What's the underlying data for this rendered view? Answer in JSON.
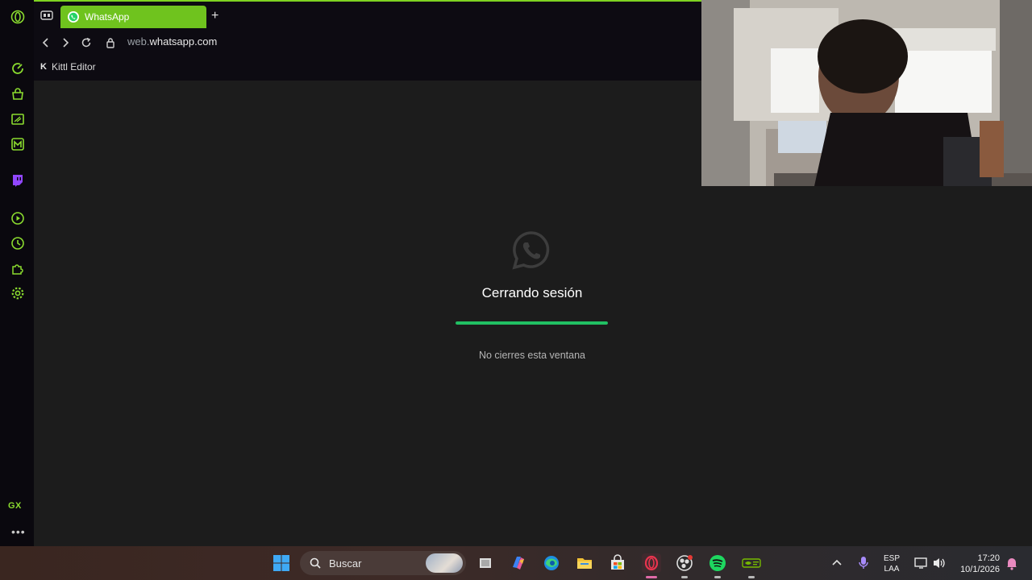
{
  "browser": {
    "tab": {
      "title": "WhatsApp"
    },
    "new_tab_symbol": "+",
    "address": {
      "url_prefix": "web.",
      "url_domain": "whatsapp.com"
    },
    "bookmarks": [
      {
        "label": "Kittl Editor",
        "icon": "kittl-icon"
      }
    ],
    "sidebar": {
      "items": [
        {
          "icon": "opera-logo-icon"
        },
        {
          "icon": "speed-dial-icon"
        },
        {
          "icon": "shopping-bag-icon"
        },
        {
          "icon": "gx-corner-icon"
        },
        {
          "icon": "messenger-m-icon"
        },
        {
          "icon": "twitch-icon"
        },
        {
          "icon": "player-icon"
        },
        {
          "icon": "history-icon"
        },
        {
          "icon": "extensions-icon"
        },
        {
          "icon": "settings-icon"
        }
      ],
      "gx_label": "GX",
      "more_label": "•••"
    },
    "accent_color": "#7ed321"
  },
  "page": {
    "title": "Cerrando sesión",
    "note": "No cierres esta ventana",
    "progress": 1.0,
    "progress_color": "#21c063"
  },
  "taskbar": {
    "search_placeholder": "Buscar",
    "apps": [
      {
        "name": "task-view"
      },
      {
        "name": "copilot"
      },
      {
        "name": "edge"
      },
      {
        "name": "file-explorer"
      },
      {
        "name": "microsoft-store"
      },
      {
        "name": "opera-gx"
      },
      {
        "name": "obs-studio"
      },
      {
        "name": "spotify"
      },
      {
        "name": "nvidia"
      }
    ],
    "language": {
      "line1": "ESP",
      "line2": "LAA"
    },
    "clock": {
      "time": "17:20",
      "date": "10/1/2026"
    }
  }
}
